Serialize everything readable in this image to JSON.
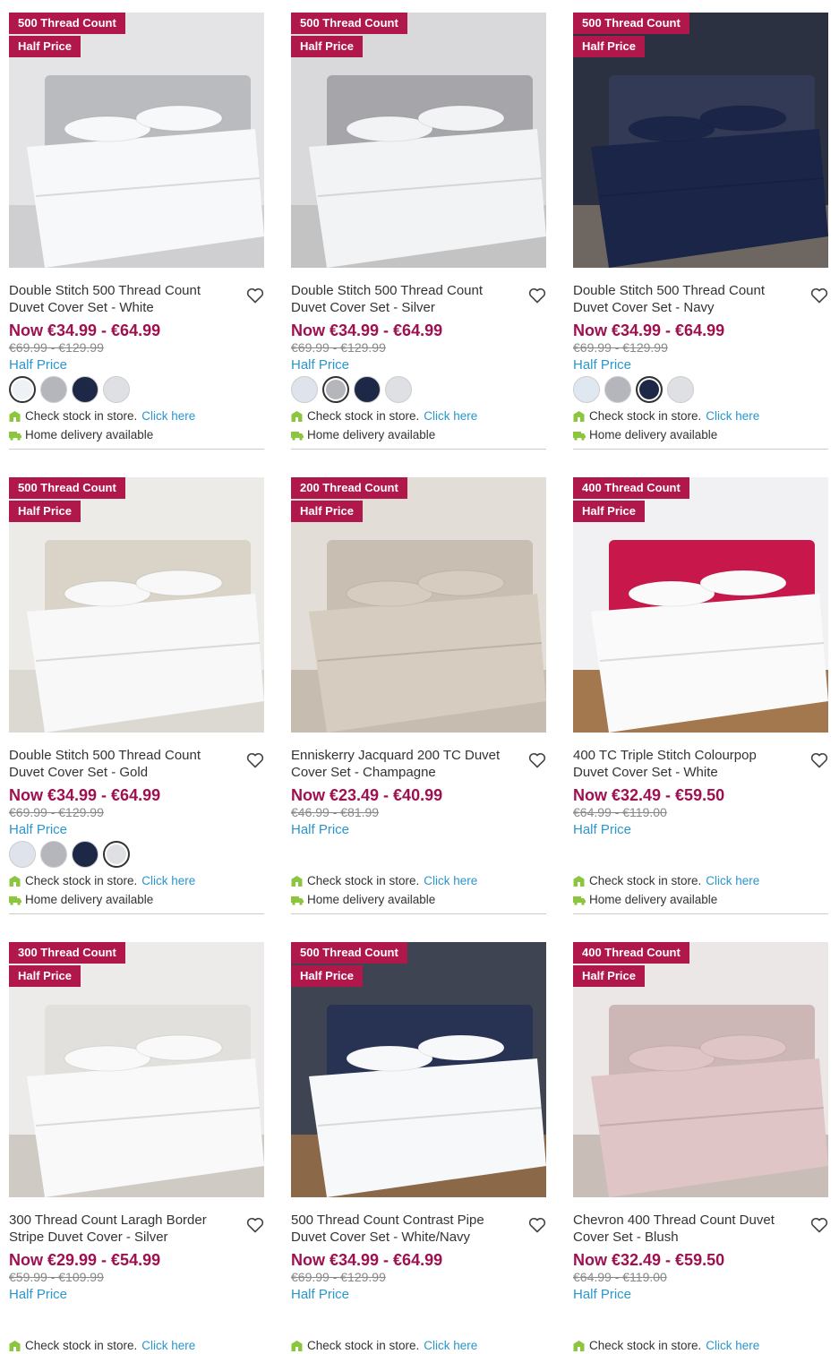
{
  "colors": {
    "badge": "#b0174a",
    "price": "#9e1050",
    "offer": "#2a96cc",
    "link": "#2a96cc",
    "icon_green": "#8cc63f"
  },
  "common": {
    "half_price_badge": "Half Price",
    "offer_label": "Half Price",
    "check_stock_text": "Check stock in store.",
    "click_here": "Click here",
    "delivery_text": "Home delivery available",
    "heart_icon": "heart-icon"
  },
  "products": [
    {
      "tc_badge": "500 Thread Count",
      "title": "Double Stitch 500 Thread Count Duvet Cover Set - White",
      "price_now": "Now €34.99 - €64.99",
      "price_was": "€69.99 - €129.99",
      "image": {
        "wall": "#e4e4e6",
        "bed": "#f7f8fa",
        "floor": "#cfcfd2",
        "head": "#b9bbbf"
      },
      "swatches": [
        {
          "color": "#eef1f5",
          "selected": true
        },
        {
          "color": "#b4b6bc",
          "selected": false
        },
        {
          "color": "#1d2846",
          "selected": false
        },
        {
          "color": "#dfe0e4",
          "selected": false
        }
      ]
    },
    {
      "tc_badge": "500 Thread Count",
      "title": "Double Stitch 500 Thread Count Duvet Cover Set - Silver",
      "price_now": "Now €34.99 - €64.99",
      "price_was": "€69.99 - €129.99",
      "image": {
        "wall": "#d9d9db",
        "bed": "#f2f3f5",
        "floor": "#c4c3c3",
        "head": "#a6a6aa"
      },
      "swatches": [
        {
          "color": "#dfe4ec",
          "selected": false
        },
        {
          "color": "#b4b6bc",
          "selected": true
        },
        {
          "color": "#1d2846",
          "selected": false
        },
        {
          "color": "#dfe0e4",
          "selected": false
        }
      ]
    },
    {
      "tc_badge": "500 Thread Count",
      "title": "Double Stitch 500 Thread Count Duvet Cover Set - Navy",
      "price_now": "Now €34.99 - €64.99",
      "price_was": "€69.99 - €129.99",
      "image": {
        "wall": "#2c3142",
        "bed": "#1a2548",
        "floor": "#6e6660",
        "head": "#333a55"
      },
      "swatches": [
        {
          "color": "#dfe8f0",
          "selected": false
        },
        {
          "color": "#b4b6bc",
          "selected": false
        },
        {
          "color": "#1d2846",
          "selected": true
        },
        {
          "color": "#dfe0e4",
          "selected": false
        }
      ]
    },
    {
      "tc_badge": "500 Thread Count",
      "title": "Double Stitch 500 Thread Count Duvet Cover Set - Gold",
      "price_now": "Now €34.99 - €64.99",
      "price_was": "€69.99 - €129.99",
      "image": {
        "wall": "#ecebe8",
        "bed": "#f8f8f8",
        "floor": "#dcd8d2",
        "head": "#d9d3c8"
      },
      "swatches": [
        {
          "color": "#dfe4ec",
          "selected": false
        },
        {
          "color": "#b4b6bc",
          "selected": false
        },
        {
          "color": "#1d2846",
          "selected": false
        },
        {
          "color": "#dfe0e4",
          "selected": true
        }
      ]
    },
    {
      "tc_badge": "200 Thread Count",
      "title": "Enniskerry Jacquard 200 TC Duvet Cover Set - Champagne",
      "price_now": "Now €23.49 - €40.99",
      "price_was": "€46.99 - €81.99",
      "image": {
        "wall": "#e2ddd6",
        "bed": "#d7ccc0",
        "floor": "#c6bcb0",
        "head": "#c9beb2"
      },
      "swatches": []
    },
    {
      "tc_badge": "400 Thread Count",
      "title": "400 TC Triple Stitch Colourpop Duvet Cover Set - White",
      "price_now": "Now €32.49 - €59.50",
      "price_was": "€64.99 - €119.00",
      "image": {
        "wall": "#f1f1f3",
        "bed": "#fafafa",
        "floor": "#a4784f",
        "head": "#c8174b"
      },
      "swatches": []
    },
    {
      "tc_badge": "300 Thread Count",
      "title": "300 Thread Count Laragh Border Stripe Duvet Cover - Silver",
      "price_now": "Now €29.99 - €54.99",
      "price_was": "€59.99 - €109.99",
      "image": {
        "wall": "#ecebea",
        "bed": "#f9f9f9",
        "floor": "#cfcac4",
        "head": "#e2e0dd"
      },
      "swatches": []
    },
    {
      "tc_badge": "500 Thread Count",
      "title": "500 Thread Count Contrast Pipe Duvet Cover Set - White/Navy",
      "price_now": "Now €34.99 - €64.99",
      "price_was": "€69.99 - €129.99",
      "image": {
        "wall": "#3e4452",
        "bed": "#f7f8fa",
        "floor": "#8a6848",
        "head": "#283252"
      },
      "swatches": []
    },
    {
      "tc_badge": "400 Thread Count",
      "title": "Chevron 400 Thread Count Duvet Cover Set - Blush",
      "price_now": "Now €32.49 - €59.50",
      "price_was": "€64.99 - €119.00",
      "image": {
        "wall": "#ebe7e6",
        "bed": "#dfc5c6",
        "floor": "#c9bdb8",
        "head": "#cdb7b6"
      },
      "swatches": []
    }
  ]
}
